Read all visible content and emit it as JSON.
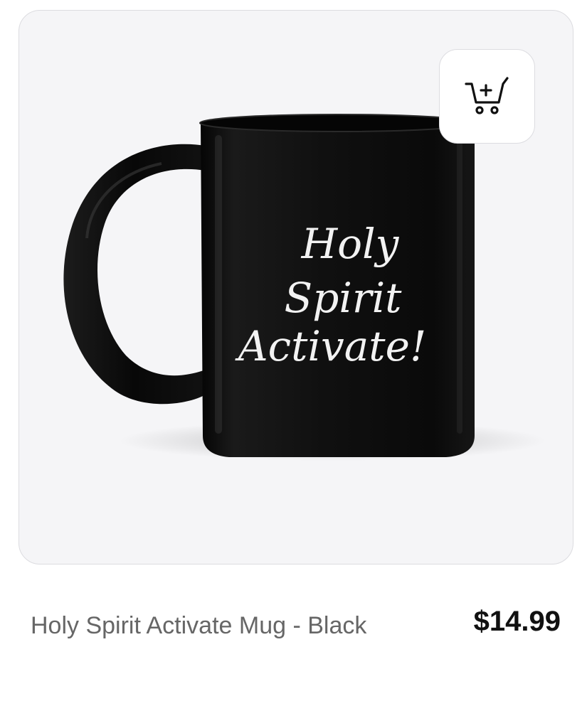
{
  "product": {
    "name": "Holy Spirit Activate Mug - Black",
    "price": "$14.99",
    "image": {
      "print_line1": "Holy",
      "print_line2": "Spirit",
      "print_line3": "Activate!",
      "mug_color": "#0d0d0d",
      "print_color": "#f2f2f2",
      "background_color": "#f5f5f7"
    }
  },
  "actions": {
    "add_to_cart_icon": "cart-plus-icon"
  }
}
